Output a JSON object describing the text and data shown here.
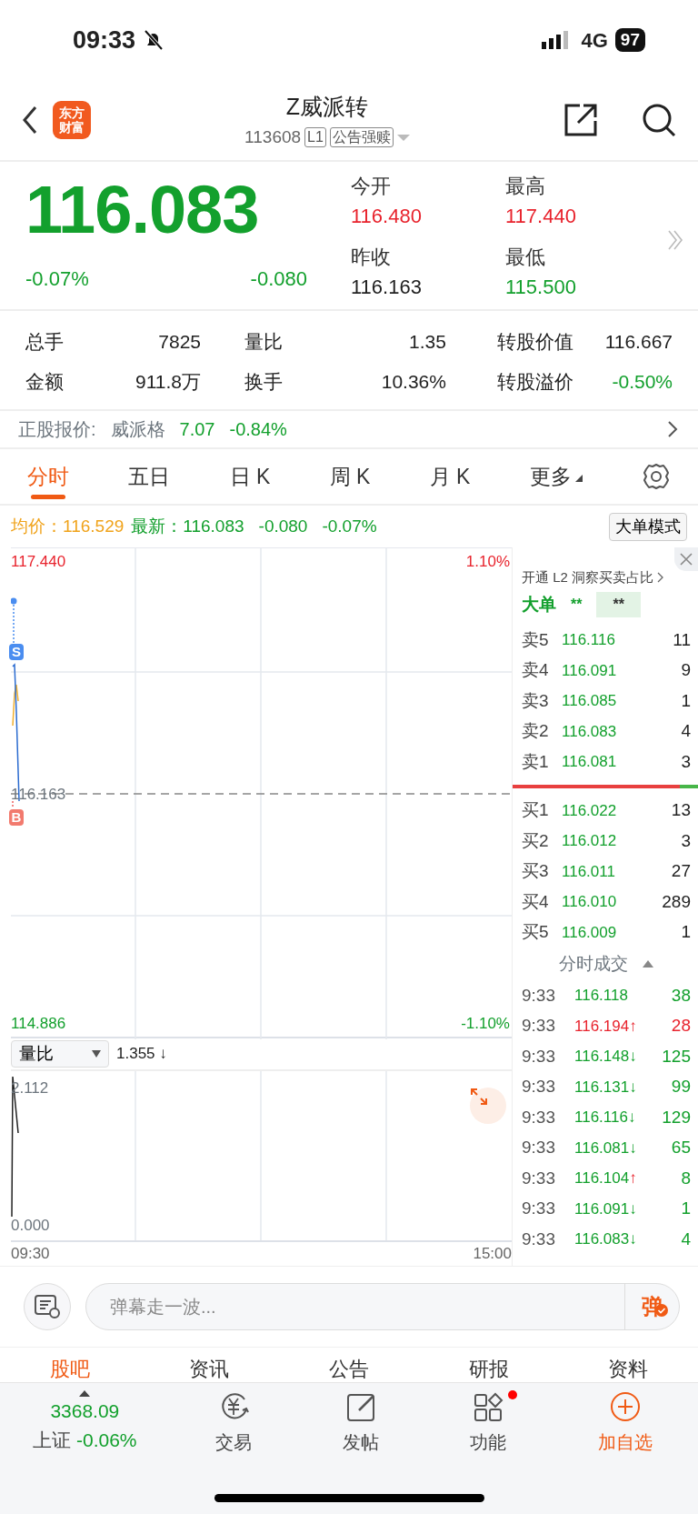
{
  "status_bar": {
    "time": "09:33",
    "network": "4G",
    "battery": "97"
  },
  "header": {
    "logo_text": [
      "东方",
      "财富"
    ],
    "title": "Z威派转",
    "code": "113608",
    "tags": [
      "L1",
      "公告强赎"
    ]
  },
  "quote": {
    "price": "116.083",
    "change_pct": "-0.07%",
    "change": "-0.080",
    "kind": "down",
    "fields": [
      {
        "label": "今开",
        "value": "116.480",
        "kind": "up"
      },
      {
        "label": "最高",
        "value": "117.440",
        "kind": "up"
      },
      {
        "label": "昨收",
        "value": "116.163",
        "kind": "flat"
      },
      {
        "label": "最低",
        "value": "115.500",
        "kind": "down"
      }
    ]
  },
  "stats": [
    [
      {
        "label": "总手",
        "value": "7825",
        "kind": "flat"
      },
      {
        "label": "量比",
        "value": "1.35",
        "kind": "flat"
      },
      {
        "label": "转股价值",
        "value": "116.667",
        "kind": "flat"
      }
    ],
    [
      {
        "label": "金额",
        "value": "911.8万",
        "kind": "flat"
      },
      {
        "label": "换手",
        "value": "10.36%",
        "kind": "flat"
      },
      {
        "label": "转股溢价",
        "value": "-0.50%",
        "kind": "down"
      }
    ]
  ],
  "stock_quote": {
    "label": "正股报价:",
    "name": "威派格",
    "price": "7.07",
    "change": "-0.84%"
  },
  "tabs": [
    {
      "label": "分时",
      "selected": true,
      "menu": false
    },
    {
      "label": "五日",
      "selected": false,
      "menu": false
    },
    {
      "label": "日 K",
      "selected": false,
      "menu": false
    },
    {
      "label": "周 K",
      "selected": false,
      "menu": false
    },
    {
      "label": "月 K",
      "selected": false,
      "menu": false
    },
    {
      "label": "更多",
      "selected": false,
      "menu": true
    }
  ],
  "info": {
    "avg_label": "均价：",
    "avg": "116.529",
    "latest_label": "最新：",
    "latest": "116.083",
    "change": "-0.080",
    "change_pct": "-0.07%",
    "button": "大单模式"
  },
  "chart": {
    "y_max": "117.440",
    "y_min": "114.886",
    "pct_max": "1.10%",
    "pct_min": "-1.10%",
    "prev_close": "116.163",
    "markers": [
      {
        "label": "S",
        "kind": "sell"
      },
      {
        "label": "B",
        "kind": "buy"
      }
    ]
  },
  "volume": {
    "selector": "量比",
    "reading": "1.355 ↓",
    "y_max": "2.112",
    "y_min": "0.000",
    "time_start": "09:30",
    "time_end": "15:00"
  },
  "order_book": {
    "promo": "开通 L2 洞察买卖占比",
    "big_order_label": "大单",
    "big_order_values": [
      "**",
      "**"
    ],
    "asks": [
      {
        "label": "卖5",
        "price": "116.116",
        "volume": "11"
      },
      {
        "label": "卖4",
        "price": "116.091",
        "volume": "9"
      },
      {
        "label": "卖3",
        "price": "116.085",
        "volume": "1"
      },
      {
        "label": "卖2",
        "price": "116.083",
        "volume": "4"
      },
      {
        "label": "卖1",
        "price": "116.081",
        "volume": "3"
      }
    ],
    "balance": {
      "level": 0.9
    },
    "bids": [
      {
        "label": "买1",
        "price": "116.022",
        "volume": "13"
      },
      {
        "label": "买2",
        "price": "116.012",
        "volume": "3"
      },
      {
        "label": "买3",
        "price": "116.011",
        "volume": "27"
      },
      {
        "label": "买4",
        "price": "116.010",
        "volume": "289"
      },
      {
        "label": "买5",
        "price": "116.009",
        "volume": "1"
      }
    ]
  },
  "trades": {
    "title": "分时成交",
    "rows": [
      {
        "time": "9:33",
        "price": "116.118",
        "kind": "down",
        "volume": "38"
      },
      {
        "time": "9:33",
        "price": "116.194",
        "kind": "up",
        "arrow": {
          "text": "↑",
          "kind": "up"
        },
        "volume": "28"
      },
      {
        "time": "9:33",
        "price": "116.148",
        "kind": "down",
        "arrow": {
          "text": "↓",
          "kind": "down"
        },
        "volume": "125"
      },
      {
        "time": "9:33",
        "price": "116.131",
        "kind": "down",
        "arrow": {
          "text": "↓",
          "kind": "down"
        },
        "volume": "99"
      },
      {
        "time": "9:33",
        "price": "116.116",
        "kind": "down",
        "arrow": {
          "text": "↓",
          "kind": "down"
        },
        "volume": "129"
      },
      {
        "time": "9:33",
        "price": "116.081",
        "kind": "down",
        "arrow": {
          "text": "↓",
          "kind": "down"
        },
        "volume": "65"
      },
      {
        "time": "9:33",
        "price": "116.104",
        "kind": "down",
        "arrow": {
          "text": "↑",
          "kind": "up"
        },
        "volume": "8"
      },
      {
        "time": "9:33",
        "price": "116.091",
        "kind": "down",
        "arrow": {
          "text": "↓",
          "kind": "down"
        },
        "volume": "1"
      },
      {
        "time": "9:33",
        "price": "116.083",
        "kind": "down",
        "arrow": {
          "text": "↓",
          "kind": "down"
        },
        "volume": "4"
      }
    ]
  },
  "comment": {
    "placeholder": "弹幕走一波...",
    "send": "弹"
  },
  "section_tabs": [
    {
      "label": "股吧",
      "selected": true
    },
    {
      "label": "资讯",
      "selected": false
    },
    {
      "label": "公告",
      "selected": false
    },
    {
      "label": "研报",
      "selected": false
    },
    {
      "label": "资料",
      "selected": false
    }
  ],
  "bottom_nav": {
    "index": {
      "value": "3368.09",
      "name": "上证",
      "change": "-0.06%"
    },
    "items": [
      {
        "label": "交易",
        "kind": "trade",
        "badge": false,
        "accent": false
      },
      {
        "label": "发帖",
        "kind": "post",
        "badge": false,
        "accent": false
      },
      {
        "label": "功能",
        "kind": "apps",
        "badge": true,
        "accent": false
      },
      {
        "label": "加自选",
        "kind": "add",
        "badge": false,
        "accent": true
      }
    ]
  }
}
